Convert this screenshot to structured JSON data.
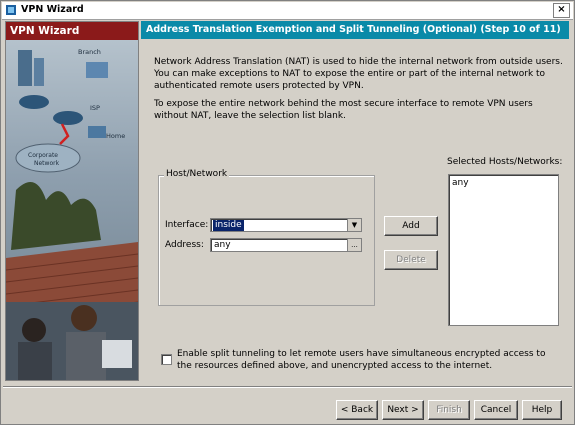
{
  "window": {
    "title": "VPN Wizard",
    "close_glyph": "×"
  },
  "left_panel": {
    "title": "VPN Wizard",
    "labels": {
      "branch": "Branch",
      "isp": "ISP",
      "home": "Home",
      "corporate": "Corporate",
      "network": "Network"
    }
  },
  "header": {
    "title": "Address Translation Exemption and Split Tunneling (Optional)   (Step 10 of 11)"
  },
  "content": {
    "description": "Network Address Translation (NAT) is used to hide the internal network from outside users. You can make exceptions to NAT to expose the entire or part of the internal network to authenticated remote users protected by VPN.",
    "description2": "To expose the entire network behind the most secure interface to remote VPN users without NAT, leave the selection list blank.",
    "group_label": "Host/Network",
    "interface_label": "Interface:",
    "interface_value": "inside",
    "address_label": "Address:",
    "address_value": "any",
    "browse_glyph": "...",
    "dropdown_glyph": "▼",
    "add_button": "Add",
    "delete_button": "Delete",
    "selected_label": "Selected Hosts/Networks:",
    "selected_items": [
      "any"
    ],
    "split_tunnel_label": "Enable split tunneling to let remote users have simultaneous encrypted access to the resources defined above, and unencrypted access to the internet.",
    "split_tunnel_checked": false
  },
  "footer": {
    "back": "< Back",
    "next": "Next >",
    "finish": "Finish",
    "cancel": "Cancel",
    "help": "Help"
  }
}
